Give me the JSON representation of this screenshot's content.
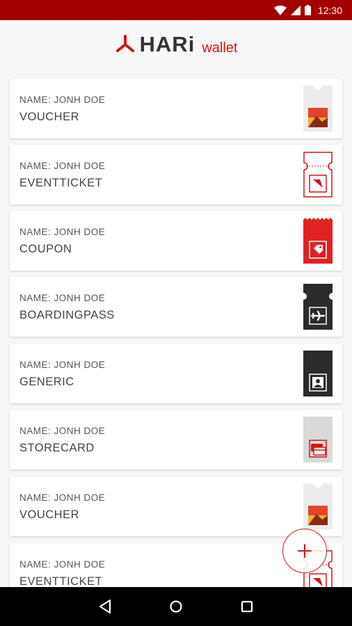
{
  "status_bar": {
    "time": "12:30"
  },
  "header": {
    "brand": "HARi",
    "brand_sub": "wallet"
  },
  "cards": [
    {
      "name": "NAME: JONH DOE",
      "type": "VOUCHER",
      "icon": "voucher-icon"
    },
    {
      "name": "NAME: JONH DOE",
      "type": "EVENTTICKET",
      "icon": "event-ticket-icon"
    },
    {
      "name": "NAME: JONH DOE",
      "type": "COUPON",
      "icon": "coupon-icon"
    },
    {
      "name": "NAME: JONH DOE",
      "type": "BOARDINGPASS",
      "icon": "boarding-pass-icon"
    },
    {
      "name": "NAME: JONH DOE",
      "type": "GENERIC",
      "icon": "generic-icon"
    },
    {
      "name": "NAME: JONH DOE",
      "type": "STORECARD",
      "icon": "store-card-icon"
    },
    {
      "name": "NAME: JONH DOE",
      "type": "VOUCHER",
      "icon": "voucher-icon"
    },
    {
      "name": "NAME: JONH DOE",
      "type": "EVENTTICKET",
      "icon": "event-ticket-icon"
    }
  ],
  "fab": {
    "icon": "add-icon"
  },
  "nav": {
    "back_icon": "back-icon",
    "home_icon": "home-icon",
    "recents_icon": "recents-icon"
  },
  "colors": {
    "status_bar": "#a30000",
    "accent": "#d31515",
    "dark_icon": "#2b2b2b"
  }
}
